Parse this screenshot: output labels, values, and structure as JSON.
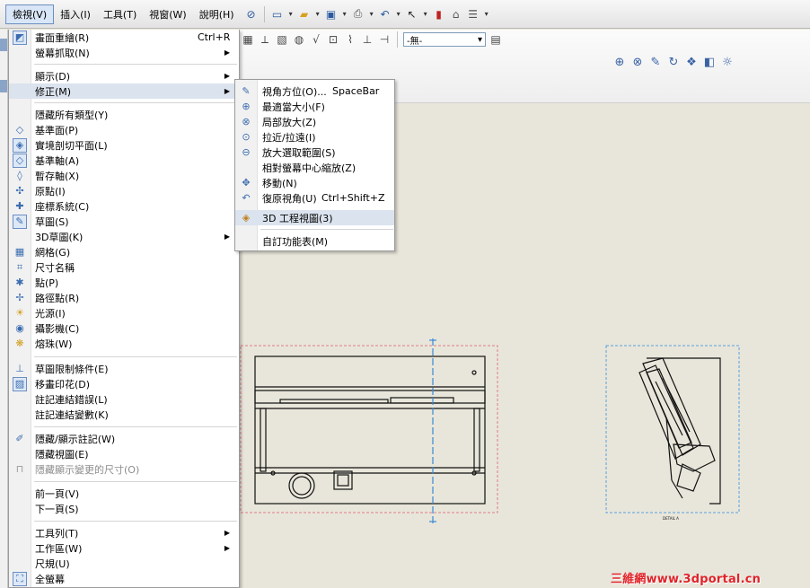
{
  "menubar": {
    "items": [
      {
        "label": "檢視(V)",
        "active": true
      },
      {
        "label": "插入(I)"
      },
      {
        "label": "工具(T)"
      },
      {
        "label": "視窗(W)"
      },
      {
        "label": "說明(H)"
      }
    ]
  },
  "toolbar2": {
    "combo_value": "-無-"
  },
  "main_menu": {
    "items": [
      {
        "label": "畫面重繪(R)",
        "shortcut": "Ctrl+R",
        "icon": "redraw-icon"
      },
      {
        "label": "螢幕抓取(N)",
        "submenu": true
      },
      {
        "label": "顯示(D)",
        "submenu": true
      },
      {
        "label": "修正(M)",
        "submenu": true,
        "highlighted": true
      },
      {
        "label": "隱藏所有類型(Y)"
      },
      {
        "label": "基準面(P)",
        "icon": "plane-icon"
      },
      {
        "label": "實境剖切平面(L)",
        "icon": "section-plane-icon"
      },
      {
        "label": "基準軸(A)",
        "icon": "axis-icon"
      },
      {
        "label": "暫存軸(X)",
        "icon": "temp-axis-icon"
      },
      {
        "label": "原點(I)",
        "icon": "origin-icon"
      },
      {
        "label": "座標系統(C)",
        "icon": "coordinate-system-icon"
      },
      {
        "label": "草圖(S)",
        "icon": "sketch-icon"
      },
      {
        "label": "3D草圖(K)",
        "submenu": true
      },
      {
        "label": "網格(G)",
        "icon": "grid-icon"
      },
      {
        "label": "尺寸名稱",
        "icon": "dimension-name-icon"
      },
      {
        "label": "點(P)",
        "icon": "point-icon"
      },
      {
        "label": "路徑點(R)",
        "icon": "route-point-icon"
      },
      {
        "label": "光源(I)",
        "icon": "light-icon"
      },
      {
        "label": "攝影機(C)",
        "icon": "camera-icon"
      },
      {
        "label": "熔珠(W)",
        "icon": "weld-bead-icon"
      },
      {
        "label": "草圖限制條件(E)",
        "icon": "sketch-relation-icon"
      },
      {
        "label": "移畫印花(D)",
        "icon": "decal-icon"
      },
      {
        "label": "註記連結錯誤(L)"
      },
      {
        "label": "註記連結變數(K)"
      },
      {
        "label": "隱藏/顯示註記(W)",
        "icon": "hide-annotation-icon"
      },
      {
        "label": "隱藏視圖(E)"
      },
      {
        "label": "隱藏顯示變更的尺寸(O)",
        "disabled": true,
        "icon": "dimension-change-icon"
      },
      {
        "label": "前一頁(V)"
      },
      {
        "label": "下一頁(S)"
      },
      {
        "label": "工具列(T)",
        "submenu": true
      },
      {
        "label": "工作區(W)",
        "submenu": true
      },
      {
        "label": "尺規(U)"
      },
      {
        "label": "全螢幕",
        "icon": "fullscreen-icon"
      }
    ]
  },
  "sub_menu": {
    "items": [
      {
        "label": "視角方位(O)...",
        "shortcut": "SpaceBar",
        "icon": "view-orientation-icon"
      },
      {
        "label": "最適當大小(F)",
        "icon": "zoom-fit-icon"
      },
      {
        "label": "局部放大(Z)",
        "icon": "zoom-area-icon"
      },
      {
        "label": "拉近/拉遠(I)",
        "icon": "zoom-inout-icon"
      },
      {
        "label": "放大選取範圍(S)",
        "icon": "zoom-selection-icon"
      },
      {
        "label": "相對螢幕中心縮放(Z)"
      },
      {
        "label": "移動(N)",
        "icon": "pan-icon"
      },
      {
        "label": "復原視角(U)",
        "shortcut": "Ctrl+Shift+Z",
        "icon": "undo-view-icon"
      },
      {
        "label": "3D 工程視圖(3)",
        "highlighted": true,
        "icon": "3d-drawing-view-icon"
      },
      {
        "label": "自訂功能表(M)"
      }
    ]
  },
  "drawing": {
    "small_label": "DETAIL A"
  },
  "watermark": "三維網www.3dportal.cn",
  "colors": {
    "menu_highlight": "#dbe3ee",
    "canvas_bg": "#e8e6da",
    "view_border_pink": "#e07a8a",
    "view_border_blue": "#5aa0dd",
    "watermark_red": "#e0242a"
  }
}
